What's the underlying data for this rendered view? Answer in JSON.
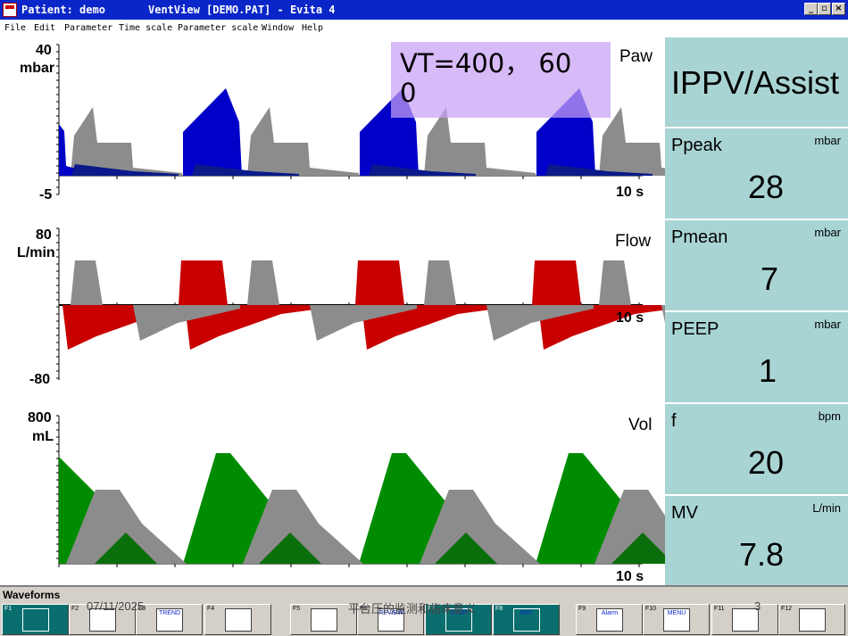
{
  "window": {
    "patient_title": "Patient: demo",
    "file_title": "VentView [DEMO.PAT] - Evita 4",
    "minimize": "_",
    "restore": "▫",
    "close": "×"
  },
  "menu": [
    "File",
    "Edit",
    "Parameter",
    "Time scale",
    "Parameter scale",
    "Window",
    "Help"
  ],
  "waveforms": {
    "paw": {
      "name": "Paw",
      "unit": "mbar",
      "max": "40",
      "min": "-5",
      "time": "10 s"
    },
    "flow": {
      "name": "Flow",
      "unit": "L/min",
      "max": "80",
      "min": "-80",
      "time": "10 s"
    },
    "vol": {
      "name": "Vol",
      "unit": "mL",
      "max": "800",
      "time": "10 s"
    },
    "colors": {
      "paw": "#0000c8",
      "flow": "#c80000",
      "vol": "#008c00",
      "spont": "#8c8c8c"
    }
  },
  "overlay": {
    "line1": "VT=400， 60",
    "line2": "0"
  },
  "mode": "IPPV/Assist",
  "params": [
    {
      "name": "Ppeak",
      "unit": "mbar",
      "value": "28"
    },
    {
      "name": "Pmean",
      "unit": "mbar",
      "value": "7"
    },
    {
      "name": "PEEP",
      "unit": "mbar",
      "value": "1"
    },
    {
      "name": "f",
      "unit": "bpm",
      "value": "20"
    },
    {
      "name": "MV",
      "unit": "L/min",
      "value": "7.8"
    }
  ],
  "toolbar": {
    "title": "Waveforms",
    "keys": [
      {
        "fn": "F1",
        "icon": "waveform-icon",
        "label": ""
      },
      {
        "fn": "F2",
        "icon": "loop-icon",
        "label": ""
      },
      {
        "fn": "F3",
        "icon": "trend-icon",
        "label": "TREND"
      },
      {
        "fn": "F4",
        "icon": "table-icon",
        "label": ""
      },
      {
        "fn": "F5",
        "icon": "grid-icon",
        "label": ""
      },
      {
        "fn": "F6",
        "icon": "review-icon",
        "label": "REVIEW"
      },
      {
        "fn": "F7",
        "icon": "stop-icon",
        "label": "STOP"
      },
      {
        "fn": "F8",
        "icon": "ref-icon",
        "label": "REF."
      },
      {
        "fn": "F9",
        "icon": "alarm-icon",
        "label": "Alarm"
      },
      {
        "fn": "F10",
        "icon": "menu-icon",
        "label": "MENU"
      },
      {
        "fn": "F11",
        "icon": "printer-icon",
        "label": ""
      },
      {
        "fn": "F12",
        "icon": "magnifier-icon",
        "label": ""
      }
    ]
  },
  "footer": {
    "date": "07/11/2025",
    "caption": "平台压的监测和临床意义",
    "page": "3"
  }
}
